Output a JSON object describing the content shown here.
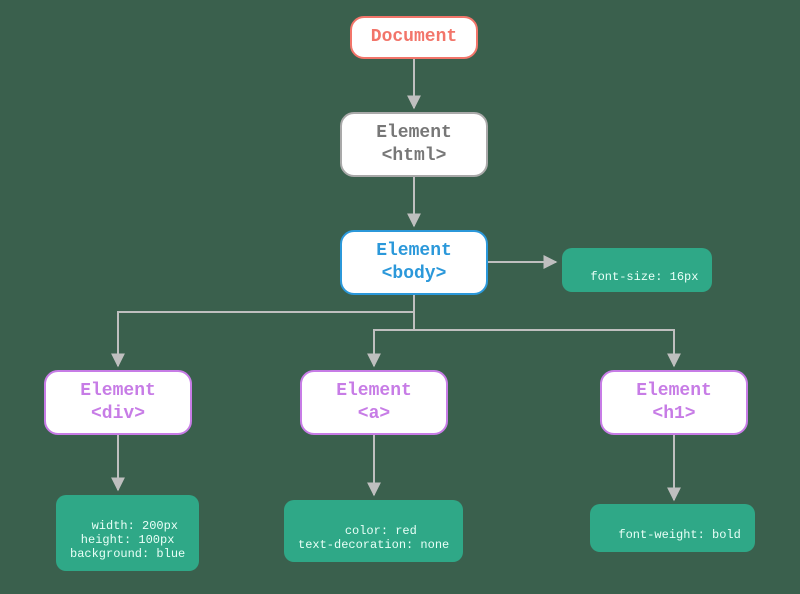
{
  "nodes": {
    "document": {
      "label": "Document"
    },
    "html": {
      "label_line1": "Element",
      "label_line2": "<html>"
    },
    "body": {
      "label_line1": "Element",
      "label_line2": "<body>"
    },
    "div": {
      "label_line1": "Element",
      "label_line2": "<div>"
    },
    "a": {
      "label_line1": "Element",
      "label_line2": "<a>"
    },
    "h1": {
      "label_line1": "Element",
      "label_line2": "<h1>"
    }
  },
  "annotations": {
    "body": "font-size: 16px",
    "div": "width: 200px\nheight: 100px\nbackground: blue",
    "a": "color: red\ntext-decoration: none",
    "h1": "font-weight: bold"
  },
  "diagram": {
    "type": "tree",
    "edges": [
      [
        "document",
        "html"
      ],
      [
        "html",
        "body"
      ],
      [
        "body",
        "div"
      ],
      [
        "body",
        "a"
      ],
      [
        "body",
        "h1"
      ]
    ],
    "annotation_edges": [
      [
        "body",
        "annotations.body"
      ],
      [
        "div",
        "annotations.div"
      ],
      [
        "a",
        "annotations.a"
      ],
      [
        "h1",
        "annotations.h1"
      ]
    ]
  },
  "colors": {
    "root_border": "#f2756a",
    "gray_border": "#a9a9a9",
    "blue_border": "#2b98da",
    "purple_border": "#c77ce6",
    "anno_bg": "#2fa887",
    "canvas_bg": "#3a604d"
  }
}
